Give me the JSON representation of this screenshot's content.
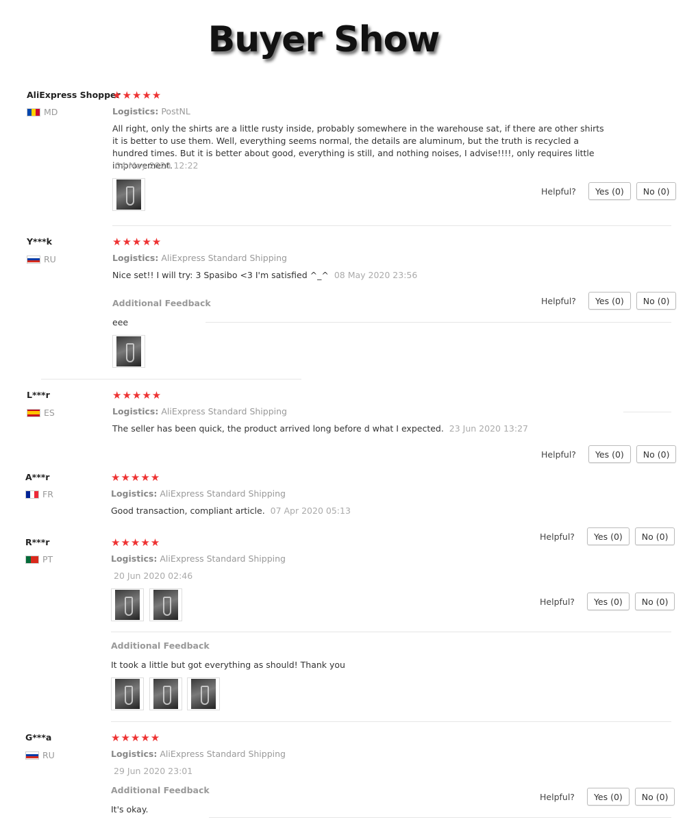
{
  "banner_title": "Buyer Show",
  "helpful_label": "Helpful?",
  "yes_label": "Yes (0)",
  "no_label": "No (0)",
  "additional_feedback_label": "Additional Feedback",
  "logistics_label": "Logistics:",
  "colors": {
    "star": "#ee3333",
    "muted": "#999999",
    "divider": "#e6e6e6"
  },
  "reviews": [
    {
      "name": "AliExpress Shopper",
      "country": "MD",
      "stars": "★★★★★",
      "logistics": "PostNL",
      "text": "All right, only the shirts are a little rusty inside, probably somewhere in the warehouse sat, if there are other shirts it is better to use them. Well, everything seems normal, the details are aluminum, but the truth is recycled a hundred times. But it is better about good, everything is still, and nothing noises, I advise!!!!, only requires little improvement.",
      "date": "04 May 2020 12:22"
    },
    {
      "name": "Y***k",
      "country": "RU",
      "stars": "★★★★★",
      "logistics": "AliExpress Standard Shipping",
      "text": "Nice set!! I will try: 3 Spasibo <3 I'm satisfied ^_^",
      "date": "08 May 2020 23:56",
      "additional": "eee"
    },
    {
      "name": "L***r",
      "country": "ES",
      "stars": "★★★★★",
      "logistics": "AliExpress Standard Shipping",
      "text": "The seller has been quick, the product arrived long before d what I expected.",
      "date": "23 Jun 2020 13:27"
    },
    {
      "name": "A***r",
      "country": "FR",
      "stars": "★★★★★",
      "logistics": "AliExpress Standard Shipping",
      "text": "Good transaction, compliant article.",
      "date": "07 Apr 2020 05:13"
    },
    {
      "name": "R***r",
      "country": "PT",
      "stars": "★★★★★",
      "logistics": "AliExpress Standard Shipping",
      "date": "20 Jun 2020 02:46",
      "additional": "It took a little but got everything as should! Thank you"
    },
    {
      "name": "G***a",
      "country": "RU",
      "stars": "★★★★★",
      "logistics": "AliExpress Standard Shipping",
      "date": "29 Jun 2020 23:01",
      "additional": "It's okay."
    }
  ]
}
